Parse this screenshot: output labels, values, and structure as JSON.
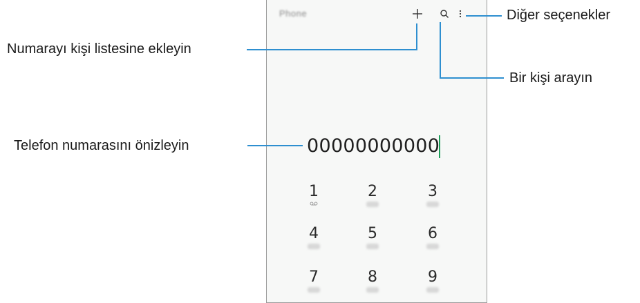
{
  "app": {
    "title": "Phone"
  },
  "toolbar": {
    "add_icon": "plus-icon",
    "search_icon": "search-icon",
    "more_icon": "more-vertical-icon"
  },
  "dialer": {
    "number": "00000000000",
    "keys": [
      {
        "digit": "1",
        "sub": "voicemail-icon"
      },
      {
        "digit": "2",
        "sub": ""
      },
      {
        "digit": "3",
        "sub": ""
      },
      {
        "digit": "4",
        "sub": ""
      },
      {
        "digit": "5",
        "sub": ""
      },
      {
        "digit": "6",
        "sub": ""
      },
      {
        "digit": "7",
        "sub": ""
      },
      {
        "digit": "8",
        "sub": ""
      },
      {
        "digit": "9",
        "sub": ""
      }
    ]
  },
  "callouts": {
    "add_contact": "Numarayı kişi listesine ekleyin",
    "more_options": "Diğer seçenekler",
    "search_contact": "Bir kişi arayın",
    "preview_number": "Telefon numarasını önizleyin"
  },
  "colors": {
    "callout_line": "#2e8fd0",
    "cursor": "#1e9e5a",
    "screen_bg": "#f7f8f7"
  }
}
